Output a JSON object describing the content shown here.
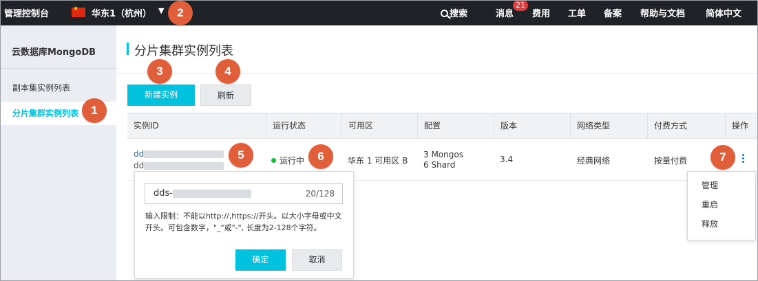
{
  "topbar": {
    "brand": "管理控制台",
    "region": "华东1（杭州）",
    "region_caret": "▼",
    "nav": {
      "search": "搜索",
      "messages": "消息",
      "messages_badge": "21",
      "fees": "费用",
      "tickets": "工单",
      "filing": "备案",
      "help": "帮助与文档",
      "language": "简体中文"
    }
  },
  "sidebar": {
    "title": "云数据库MongoDB",
    "items": [
      {
        "label": "副本集实例列表"
      },
      {
        "label": "分片集群实例列表"
      }
    ]
  },
  "main": {
    "title": "分片集群实例列表",
    "buttons": {
      "create": "新建实例",
      "refresh": "刷新"
    },
    "table": {
      "headers": [
        "实例ID",
        "运行状态",
        "可用区",
        "配置",
        "版本",
        "网络类型",
        "付费方式",
        "操作"
      ],
      "row": {
        "id_prefix_1": "dd",
        "id_prefix_2": "dd",
        "status": "运行中",
        "zone": "华东 1 可用区 B",
        "config_line1": "3 Mongos",
        "config_line2": "6 Shard",
        "version": "3.4",
        "network": "经典网络",
        "billing": "按量付费"
      }
    },
    "popover": {
      "input_value": "dds-",
      "counter": "20/128",
      "hint": "输入限制：不能以http://,https://开头。以大小字母或中文开头。可包含数字，\"_\"或\"-\", 长度为2-128个字符。",
      "confirm": "确定",
      "cancel": "取消"
    },
    "action_menu": [
      "管理",
      "重启",
      "释放"
    ]
  },
  "callouts": [
    "1",
    "2",
    "3",
    "4",
    "5",
    "6",
    "7"
  ],
  "colors": {
    "accent": "#00c1de",
    "callout": "#e05e3a",
    "topbar": "#1f2227",
    "status_running": "#1ab93c"
  }
}
